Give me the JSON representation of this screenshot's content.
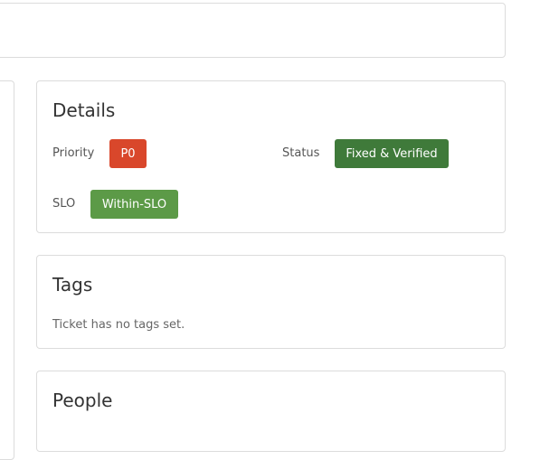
{
  "details": {
    "title": "Details",
    "priority_label": "Priority",
    "priority_value": "P0",
    "status_label": "Status",
    "status_value": "Fixed & Verified",
    "slo_label": "SLO",
    "slo_value": "Within-SLO"
  },
  "tags": {
    "title": "Tags",
    "empty_text": "Ticket has no tags set."
  },
  "people": {
    "title": "People"
  },
  "colors": {
    "priority_badge": "#d9472b",
    "status_badge": "#3f7a3a",
    "slo_badge": "#5c9a47"
  }
}
